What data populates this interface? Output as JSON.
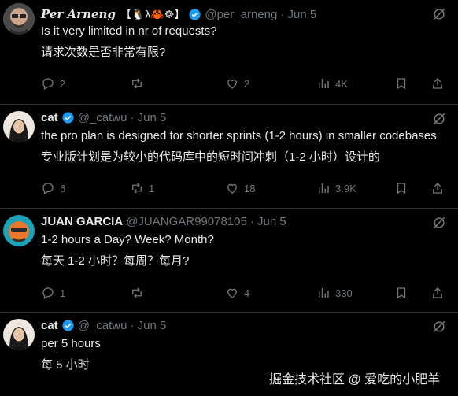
{
  "tweets": [
    {
      "name": "Per Arneng",
      "emojis": "【🐧λ🦀☸】",
      "handle": "@per_arneng",
      "date": "· Jun 5",
      "lines": [
        "Is it very limited in nr of requests?",
        "请求次数是否非常有限?"
      ],
      "actions": {
        "reply": "2",
        "retweet": "",
        "like": "2",
        "views": "4K"
      }
    },
    {
      "name": "cat",
      "handle": "@_catwu",
      "date": "· Jun 5",
      "lines": [
        "the pro plan is designed for shorter sprints (1-2 hours) in smaller codebases",
        "专业版计划是为较小的代码库中的短时间冲刺（1-2 小时）设计的"
      ],
      "actions": {
        "reply": "6",
        "retweet": "1",
        "like": "18",
        "views": "3.9K"
      }
    },
    {
      "name": "JUAN GARCIA",
      "handle": "@JUANGAR99078105",
      "date": "· Jun 5",
      "lines": [
        "1-2 hours a Day? Week? Month?",
        "每天 1-2 小时？每周？每月?"
      ],
      "actions": {
        "reply": "1",
        "retweet": "",
        "like": "4",
        "views": "330"
      }
    },
    {
      "name": "cat",
      "handle": "@_catwu",
      "date": "· Jun 5",
      "lines": [
        "per 5 hours",
        "每 5 小时"
      ]
    }
  ],
  "watermark": "掘金技术社区 @ 爱吃的小肥羊",
  "icons": {
    "more": "grok-slash-icon",
    "reply": "reply-icon",
    "retweet": "retweet-icon",
    "like": "heart-icon",
    "views": "views-icon",
    "bookmark": "bookmark-icon",
    "share": "share-icon",
    "verified": "verified-badge-icon"
  },
  "colors": {
    "background": "#000000",
    "text": "#e7e9ea",
    "muted": "#71767b",
    "verified": "#1d9bf0",
    "divider": "#2f3336"
  }
}
